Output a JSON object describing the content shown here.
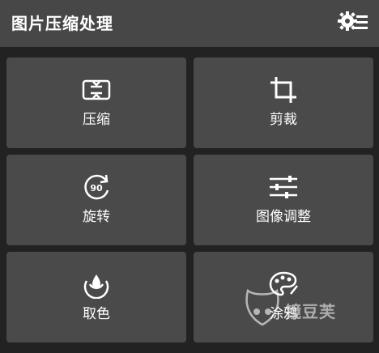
{
  "header": {
    "title": "图片压缩处理",
    "settings_icon": "settings-gear-list-icon"
  },
  "tiles": [
    {
      "label": "压缩",
      "icon": "compress-icon"
    },
    {
      "label": "剪裁",
      "icon": "crop-icon"
    },
    {
      "label": "旋转",
      "icon": "rotate-90-icon"
    },
    {
      "label": "图像调整",
      "icon": "adjust-sliders-icon"
    },
    {
      "label": "取色",
      "icon": "color-picker-icon"
    },
    {
      "label": "涂鸦",
      "icon": "palette-icon"
    }
  ],
  "watermark": {
    "text": "镜豆芙"
  },
  "colors": {
    "background": "#222222",
    "header": "#474747",
    "tile": "#4a4a4a",
    "text": "#ffffff"
  }
}
